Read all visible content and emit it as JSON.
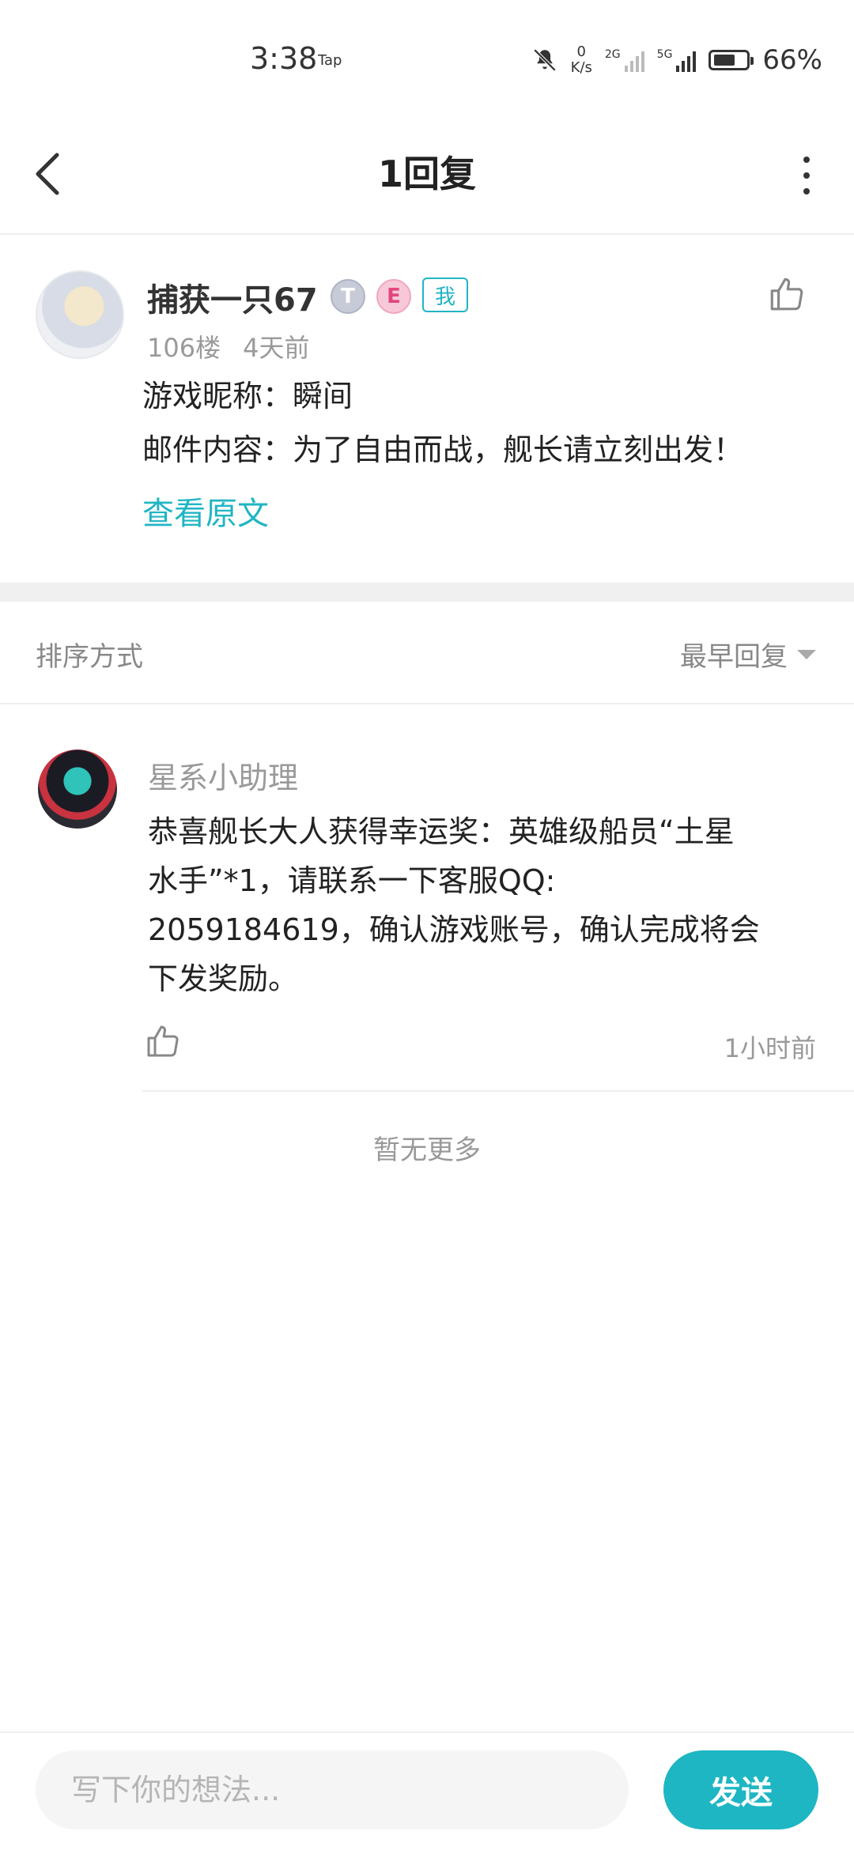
{
  "status_bar": {
    "time": "3:38",
    "carrier_tag": "Tap",
    "net_speed_value": "0",
    "net_speed_unit": "K/s",
    "signal_1_tag": "2G",
    "signal_2_tag": "5G",
    "battery": "66%",
    "battery_level": 0.66,
    "icons": [
      "bell-off-icon",
      "signal-icon",
      "battery-icon"
    ]
  },
  "nav": {
    "title": "1回复",
    "icons": [
      "chevron-left-icon",
      "more-vertical-icon"
    ]
  },
  "post": {
    "username": "捕获一只67",
    "badge_t": "T",
    "badge_e": "E",
    "badge_me": "我",
    "floor": "106楼",
    "time": "4天前",
    "line1": "游戏昵称：瞬间",
    "line2": "邮件内容：为了自由而战，舰长请立刻出发！",
    "view_original": "查看原文",
    "icons": [
      "thumbs-up-icon"
    ]
  },
  "sort": {
    "label": "排序方式",
    "value": "最早回复",
    "icons": [
      "caret-down-icon"
    ]
  },
  "reply": {
    "name": "星系小助理",
    "text_lines": [
      "恭喜舰长大人获得幸运奖：英雄级船员“土星",
      "水手”*1，请联系一下客服QQ:",
      "2059184619，确认游戏账号，确认完成将会",
      "下发奖励。"
    ],
    "time": "1小时前",
    "icons": [
      "thumbs-up-icon"
    ]
  },
  "footer": {
    "no_more": "暂无更多"
  },
  "composer": {
    "placeholder": "写下你的想法...",
    "value": "",
    "send_label": "发送"
  },
  "colors": {
    "accent": "#1eb6c3",
    "text_primary": "#222222",
    "text_secondary": "#999999",
    "divider": "#eeeeee"
  }
}
